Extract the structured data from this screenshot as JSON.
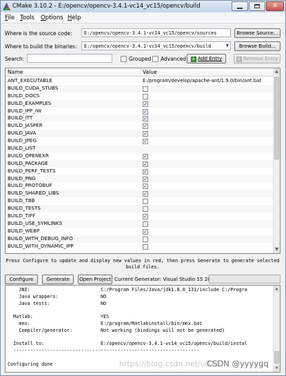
{
  "window": {
    "title": "CMake 3.10.2 - E:/opencv/opencv-3.4.1-vc14_vc15/opencv/build"
  },
  "menu": {
    "file": {
      "u": "F",
      "rest": "ile"
    },
    "tools": {
      "u": "T",
      "rest": "ools"
    },
    "options": {
      "u": "O",
      "rest": "ptions"
    },
    "help": {
      "u": "H",
      "rest": "elp"
    }
  },
  "source": {
    "label": "Where is the source code:",
    "value": "E:/opencv/opencv-3.4.1-vc14_vc15/opencv/sources",
    "browse_label": "Browse Source..."
  },
  "build": {
    "label": "Where to build the binaries:",
    "value": "E:/opencv/opencv-3.4.1-vc14_vc15/opencv/build",
    "browse_label": "Browse Build..."
  },
  "search": {
    "label": "Search:",
    "value": "",
    "grouped_label": "Grouped",
    "advanced_label": "Advanced",
    "add_entry_label": "Add Entry",
    "remove_entry_label": "Remove Entry"
  },
  "table": {
    "col_name": "Name",
    "col_value": "Value",
    "rows": [
      {
        "name": "ANT_EXECUTABLE",
        "type": "text",
        "value": "E:/program/develop/apache-ant/1.9.0/bin/ant.bat"
      },
      {
        "name": "BUILD_CUDA_STUBS",
        "type": "bool",
        "checked": false
      },
      {
        "name": "BUILD_DOCS",
        "type": "bool",
        "checked": false
      },
      {
        "name": "BUILD_EXAMPLES",
        "type": "bool",
        "checked": true
      },
      {
        "name": "BUILD_IPP_IW",
        "type": "bool",
        "checked": true
      },
      {
        "name": "BUILD_ITT",
        "type": "bool",
        "checked": true
      },
      {
        "name": "BUILD_JASPER",
        "type": "bool",
        "checked": true
      },
      {
        "name": "BUILD_JAVA",
        "type": "bool",
        "checked": true
      },
      {
        "name": "BUILD_JPEG",
        "type": "bool",
        "checked": true
      },
      {
        "name": "BUILD_LIST",
        "type": "text",
        "value": ""
      },
      {
        "name": "BUILD_OPENEXR",
        "type": "bool",
        "checked": true
      },
      {
        "name": "BUILD_PACKAGE",
        "type": "bool",
        "checked": true
      },
      {
        "name": "BUILD_PERF_TESTS",
        "type": "bool",
        "checked": true
      },
      {
        "name": "BUILD_PNG",
        "type": "bool",
        "checked": true
      },
      {
        "name": "BUILD_PROTOBUF",
        "type": "bool",
        "checked": true
      },
      {
        "name": "BUILD_SHARED_LIBS",
        "type": "bool",
        "checked": true
      },
      {
        "name": "BUILD_TBB",
        "type": "bool",
        "checked": false
      },
      {
        "name": "BUILD_TESTS",
        "type": "bool",
        "checked": false
      },
      {
        "name": "BUILD_TIFF",
        "type": "bool",
        "checked": true
      },
      {
        "name": "BUILD_USE_SYMLINKS",
        "type": "bool",
        "checked": false
      },
      {
        "name": "BUILD_WEBP",
        "type": "bool",
        "checked": true
      },
      {
        "name": "BUILD_WITH_DEBUG_INFO",
        "type": "bool",
        "checked": false
      },
      {
        "name": "BUILD_WITH_DYNAMIC_IPP",
        "type": "bool",
        "checked": false
      }
    ]
  },
  "hint": {
    "line1": "Press Configure to update and display new values in red, then press Generate to generate selected",
    "line2": "build files."
  },
  "actions": {
    "configure_label": "Configure",
    "generate_label": "Generate",
    "open_project_label": "Open Project",
    "current_generator": "Current Generator: Visual Studio 15 2017 Win64"
  },
  "output": {
    "lines": [
      "    JNI:                         C:/Program Files/Java/jdk1.8.0_131/include C:/Progra",
      "    Java wrappers:               NO",
      "    Java tests:                  NO",
      "",
      "  Matlab:                        YES",
      "    mex:                         E:/program/Matlabinstall/bin/mex.bat",
      "    Compiler/generator:          Not working (bindings will not be generated)",
      "",
      "  Install to:                    E:/opencv/opencv-3.4.1-vc14_vc15/opencv/build/instal",
      "  ------------------------------------------------------------------",
      "",
      "Configuring done"
    ]
  },
  "watermark": {
    "text1": "https://blog.csdn.net/u011",
    "text2": "CSDN @yyyygq"
  },
  "colors": {
    "check": "#1e3a7a",
    "add_icon": "#2a8a2a",
    "remove_icon": "#b0b0b0"
  }
}
